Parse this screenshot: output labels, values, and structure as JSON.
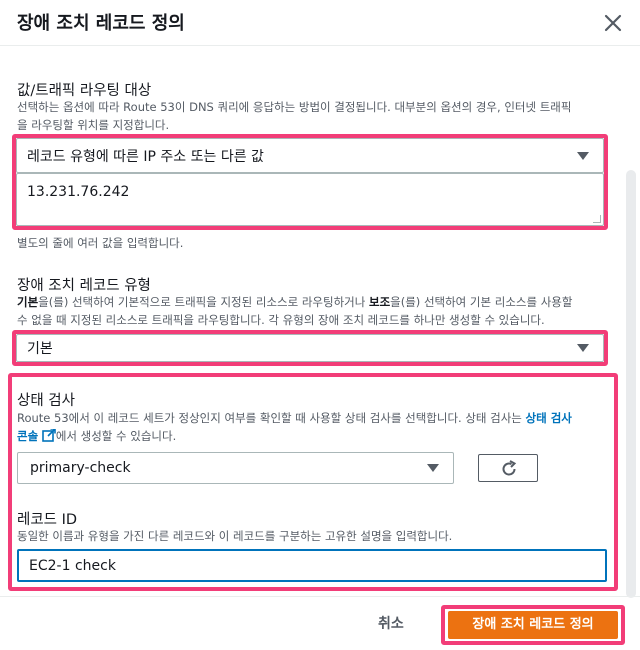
{
  "dialog": {
    "title": "장애 조치 레코드 정의"
  },
  "routing": {
    "label": "값/트래픽 라우팅 대상",
    "description_line1": "선택하는 옵션에 따라 Route 53이 DNS 쿼리에 응답하는 방법이 결정됩니다. 대부분의 옵션의 경우, 인터넷 트래픽",
    "description_line2": "을 라우팅할 위치를 지정합니다.",
    "selected": "레코드 유형에 따른 IP 주소 또는 다른 값",
    "value": "13.231.76.242",
    "hint": "별도의 줄에 여러 값을 입력합니다."
  },
  "failover_type": {
    "label": "장애 조치 레코드 유형",
    "desc_bold1": "기본",
    "desc_part1": "을(를) 선택하여 기본적으로 트래픽을 지정된 리소스로 라우팅하거나 ",
    "desc_bold2": "보조",
    "desc_part2": "을(를) 선택하여 기본 리소스를 사용할",
    "desc_line2": "수 없을 때 지정된 리소스로 트래픽을 라우팅합니다. 각 유형의 장애 조치 레코드를 하나만 생성할 수 있습니다.",
    "selected": "기본"
  },
  "health_check": {
    "label": "상태 검사",
    "desc_part1": "Route 53에서 이 레코드 세트가 정상인지 여부를 확인할 때 사용할 상태 검사를 선택합니다. 상태 검사는 ",
    "link1": "상태 검사",
    "link2": "콘솔",
    "desc_part2": "에서 생성할 수 있습니다.",
    "selected": "primary-check"
  },
  "record_id": {
    "label": "레코드 ID",
    "description": "동일한 이름과 유형을 가진 다른 레코드와 이 레코드를 구분하는 고유한 설명을 입력합니다.",
    "value": "EC2-1 check"
  },
  "footer": {
    "cancel_label": "취소",
    "submit_label": "장애 조치 레코드 정의"
  },
  "colors": {
    "highlight": "#f23d78",
    "primary_button": "#ec7211",
    "link": "#0073bb"
  }
}
